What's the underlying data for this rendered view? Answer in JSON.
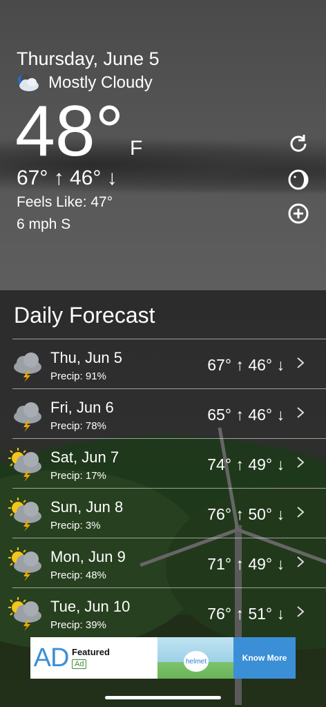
{
  "current": {
    "date": "Thursday, June 5",
    "condition": "Mostly Cloudy",
    "condition_icon": "partly-cloudy-night-icon",
    "temperature": "48°",
    "unit": "F",
    "hilo": "67° ↑  46° ↓",
    "feels_like": "Feels Like: 47°",
    "wind": "6 mph S"
  },
  "side_buttons": [
    {
      "name": "refresh-icon"
    },
    {
      "name": "moon-phase-icon"
    },
    {
      "name": "add-location-icon"
    }
  ],
  "daily": {
    "title": "Daily Forecast",
    "days": [
      {
        "day": "Thu, Jun 5",
        "precip": "Precip: 91%",
        "temps": "67° ↑  46° ↓",
        "icon": "thunderstorm-icon"
      },
      {
        "day": "Fri, Jun 6",
        "precip": "Precip: 78%",
        "temps": "65° ↑  46° ↓",
        "icon": "thunderstorm-icon"
      },
      {
        "day": "Sat, Jun 7",
        "precip": "Precip: 17%",
        "temps": "74° ↑  49° ↓",
        "icon": "sun-thunderstorm-icon"
      },
      {
        "day": "Sun, Jun 8",
        "precip": "Precip: 3%",
        "temps": "76° ↑  50° ↓",
        "icon": "sun-thunderstorm-icon"
      },
      {
        "day": "Mon, Jun 9",
        "precip": "Precip: 48%",
        "temps": "71° ↑  49° ↓",
        "icon": "sun-thunderstorm-icon"
      },
      {
        "day": "Tue, Jun 10",
        "precip": "Precip: 39%",
        "temps": "76° ↑  51° ↓",
        "icon": "sun-thunderstorm-icon"
      }
    ]
  },
  "ad": {
    "logo": "AD",
    "featured": "Featured",
    "badge": "Ad",
    "image_text": "helmet",
    "cta": "Know More"
  },
  "colors": {
    "ad_accent": "#3b8fd6",
    "sun": "#f5c518",
    "bolt": "#f0a800"
  }
}
